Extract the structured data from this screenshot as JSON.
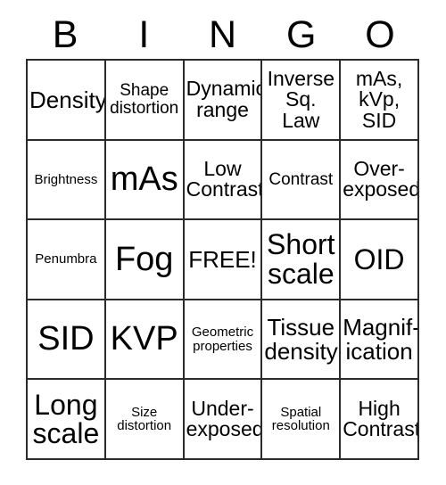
{
  "card": {
    "title": "BINGO",
    "header_letters": [
      "B",
      "I",
      "N",
      "G",
      "O"
    ],
    "free_space_label": "FREE!",
    "colors": {
      "background": "#ffffff",
      "text": "#000000",
      "grid_line": "#2b2b2b"
    },
    "grid": {
      "columns": 5,
      "rows": 5,
      "cells": [
        {
          "text": "Density",
          "size": "fs-l"
        },
        {
          "text": "Shape\ndistortion",
          "size": "fs-s"
        },
        {
          "text": "Dynamic\nrange",
          "size": "fs-m"
        },
        {
          "text": "Inverse\nSq.\nLaw",
          "size": "fs-m"
        },
        {
          "text": "mAs,\nkVp,\nSID",
          "size": "fs-m"
        },
        {
          "text": "Brightness",
          "size": "fs-xs"
        },
        {
          "text": "mAs",
          "size": "fs-xxl"
        },
        {
          "text": "Low\nContrast",
          "size": "fs-m"
        },
        {
          "text": "Contrast",
          "size": "fs-s"
        },
        {
          "text": "Over-\nexposed",
          "size": "fs-m"
        },
        {
          "text": "Penumbra",
          "size": "fs-xs"
        },
        {
          "text": "Fog",
          "size": "fs-xxl"
        },
        {
          "text": "FREE!",
          "size": "fs-l"
        },
        {
          "text": "Short\nscale",
          "size": "fs-xl"
        },
        {
          "text": "OID",
          "size": "fs-xl"
        },
        {
          "text": "SID",
          "size": "fs-xxl"
        },
        {
          "text": "KVP",
          "size": "fs-xxl"
        },
        {
          "text": "Geometric\nproperties",
          "size": "fs-xs"
        },
        {
          "text": "Tissue\ndensity",
          "size": "fs-l"
        },
        {
          "text": "Magnif-\nication",
          "size": "fs-l"
        },
        {
          "text": "Long\nscale",
          "size": "fs-xl"
        },
        {
          "text": "Size\ndistortion",
          "size": "fs-xs"
        },
        {
          "text": "Under-\nexposed",
          "size": "fs-m"
        },
        {
          "text": "Spatial\nresolution",
          "size": "fs-xs"
        },
        {
          "text": "High\nContrast",
          "size": "fs-m"
        }
      ]
    }
  }
}
